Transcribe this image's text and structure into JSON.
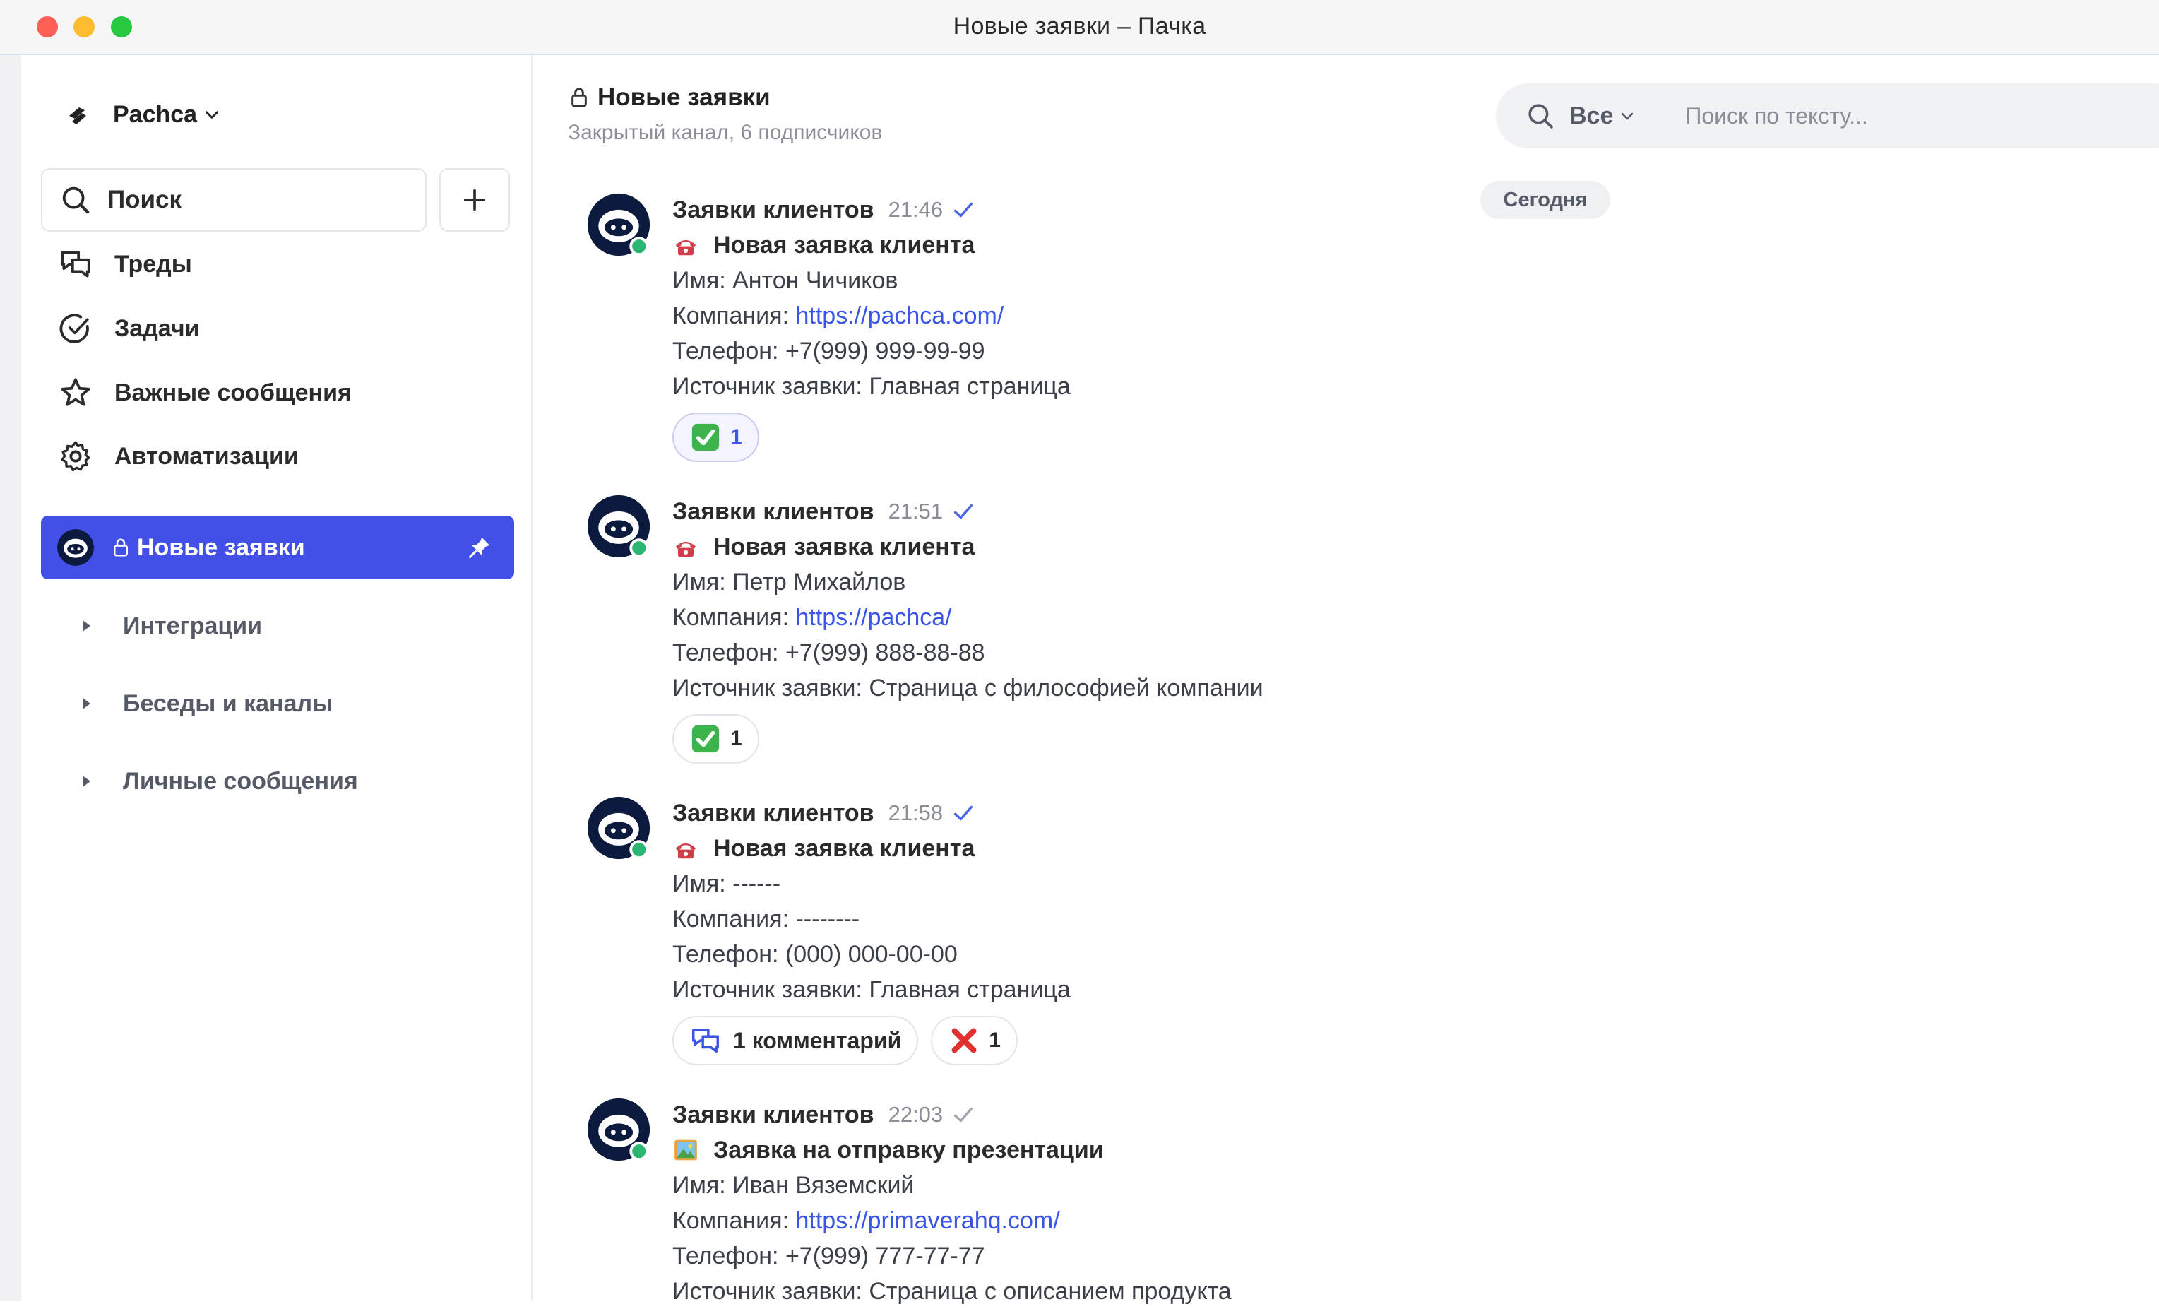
{
  "window": {
    "title": "Новые заявки – Пачка"
  },
  "sidebar": {
    "workspace": "Pachca",
    "search_label": "Поиск",
    "nav": [
      {
        "label": "Треды",
        "icon": "threads-icon"
      },
      {
        "label": "Задачи",
        "icon": "check-circle-icon"
      },
      {
        "label": "Важные сообщения",
        "icon": "star-icon"
      },
      {
        "label": "Автоматизации",
        "icon": "gear-icon"
      }
    ],
    "active_channel": {
      "label": "Новые заявки",
      "pinned": true
    },
    "sections": [
      {
        "label": "Интеграции"
      },
      {
        "label": "Беседы и каналы"
      },
      {
        "label": "Личные сообщения"
      }
    ]
  },
  "header": {
    "title": "Новые заявки",
    "subtitle": "Закрытый канал, 6 подписчиков",
    "filter": "Все",
    "search_placeholder": "Поиск по тексту..."
  },
  "date_divider": "Сегодня",
  "messages": [
    {
      "author": "Заявки клиентов",
      "time": "21:46",
      "title": "Новая заявка клиента",
      "name": "Имя: Антон Чичиков",
      "company_prefix": "Компания: ",
      "company_link": "https://pachca.com/",
      "phone": "Телефон: +7(999) 999-99-99",
      "source": "Источник заявки: Главная страница",
      "reaction_count": "1"
    },
    {
      "author": "Заявки клиентов",
      "time": "21:51",
      "title": "Новая заявка клиента",
      "name": "Имя: Петр Михайлов",
      "company_prefix": "Компания: ",
      "company_link": "https://pachca/",
      "phone": "Телефон: +7(999) 888-88-88",
      "source": "Источник заявки: Страница с философией компании",
      "reaction_count": "1"
    },
    {
      "author": "Заявки клиентов",
      "time": "21:58",
      "title": "Новая заявка клиента",
      "name": "Имя: ------",
      "company": "Компания: --------",
      "phone": "Телефон: (000) 000-00-00",
      "source": "Источник заявки: Главная страница",
      "comments": "1 комментарий",
      "reaction_count": "1"
    },
    {
      "author": "Заявки клиентов",
      "time": "22:03",
      "title": "Заявка на отправку презентации",
      "name": "Имя: Иван Вяземский",
      "company_prefix": "Компания: ",
      "company_link": "https://primaverahq.com/",
      "phone": "Телефон: +7(999) 777-77-77",
      "source": "Источник заявки: Страница с описанием продукта"
    }
  ],
  "colors": {
    "accent": "#4350e8",
    "link": "#3b55e6",
    "online": "#2bb673"
  }
}
